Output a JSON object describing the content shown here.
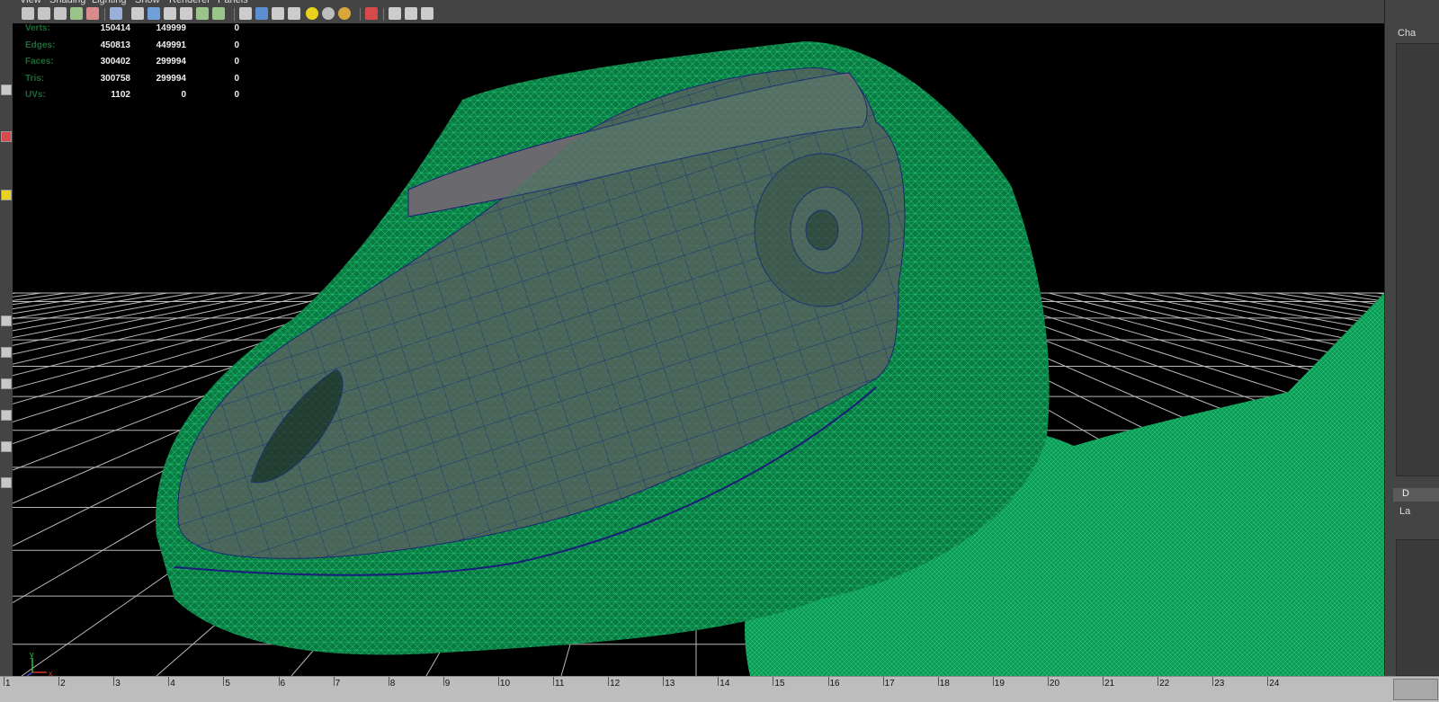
{
  "menubar": {
    "items": [
      "View",
      "Shading",
      "Lighting",
      "Show",
      "Renderer",
      "Panels"
    ]
  },
  "toolbar": {
    "icons": [
      {
        "name": "camera-select-icon",
        "color": "#c6c6c6"
      },
      {
        "name": "camera-attributes-icon",
        "color": "#c6c6c6"
      },
      {
        "name": "bookmark-icon",
        "color": "#c6c6c6"
      },
      {
        "name": "image-plane-icon",
        "color": "#9bc48a"
      },
      {
        "name": "grease-pencil-icon",
        "color": "#d98a8a"
      },
      {
        "name": "grid-icon",
        "color": "#9ab0d6"
      },
      {
        "name": "film-gate-icon",
        "color": "#cccccc"
      },
      {
        "name": "resolution-gate-icon",
        "color": "#6fa0d9"
      },
      {
        "name": "gate-mask-icon",
        "color": "#cccccc"
      },
      {
        "name": "field-chart-icon",
        "color": "#cccccc"
      },
      {
        "name": "safe-action-icon",
        "color": "#9bc48a"
      },
      {
        "name": "safe-title-icon",
        "color": "#9bc48a"
      },
      {
        "name": "wireframe-icon",
        "color": "#cccccc"
      },
      {
        "name": "smooth-shade-icon",
        "color": "#5c8fd1"
      },
      {
        "name": "wireframe-on-shaded-icon",
        "color": "#cccccc"
      },
      {
        "name": "textured-icon",
        "color": "#cccccc"
      },
      {
        "name": "use-all-lights-icon",
        "color": "#e8d21e"
      },
      {
        "name": "shadows-icon",
        "color": "#bdbdbd"
      },
      {
        "name": "screen-space-ao-icon",
        "color": "#d9a63a"
      },
      {
        "name": "isolate-select-icon",
        "color": "#d64a4a"
      },
      {
        "name": "xray-icon",
        "color": "#cccccc"
      },
      {
        "name": "xray-joints-icon",
        "color": "#cccccc"
      },
      {
        "name": "xray-components-icon",
        "color": "#cccccc"
      }
    ]
  },
  "hud": {
    "rows": [
      {
        "label": "Verts:",
        "v1": "150414",
        "v2": "149999",
        "v3": "0"
      },
      {
        "label": "Edges:",
        "v1": "450813",
        "v2": "449991",
        "v3": "0"
      },
      {
        "label": "Faces:",
        "v1": "300402",
        "v2": "299994",
        "v3": "0"
      },
      {
        "label": "Tris:",
        "v1": "300758",
        "v2": "299994",
        "v3": "0"
      },
      {
        "label": "UVs:",
        "v1": "1102",
        "v2": "0",
        "v3": "0"
      }
    ]
  },
  "axis": {
    "x": "x",
    "y": "y"
  },
  "right_panel": {
    "header": "Cha",
    "tab": "D",
    "layer_label": "La"
  },
  "timeline": {
    "ticks": [
      "1",
      "2",
      "3",
      "4",
      "5",
      "6",
      "7",
      "8",
      "9",
      "10",
      "11",
      "12",
      "13",
      "14",
      "15",
      "16",
      "17",
      "18",
      "19",
      "20",
      "21",
      "22",
      "23",
      "24"
    ]
  },
  "colors": {
    "viewport_bg": "#000000",
    "mesh_green": "#0e9a55",
    "mesh_gray": "#5a5a5e",
    "hud_label": "#1b6b34",
    "grid": "#b8b8b8"
  }
}
